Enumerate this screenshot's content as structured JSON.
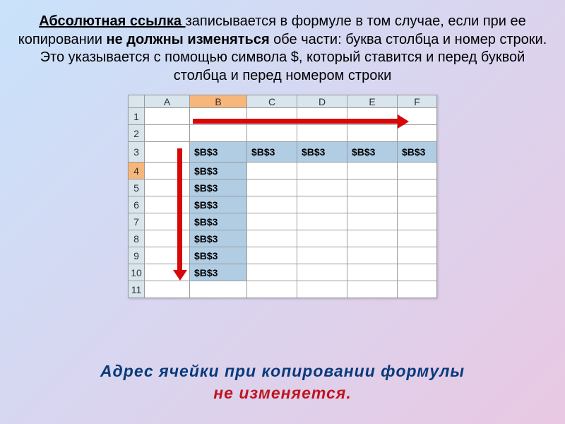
{
  "para": {
    "title": "Абсолютная ссылка ",
    "part1": "записывается в формуле в том случае, если при ее копировании ",
    "bold": "не должны изменяться",
    "part2": " обе части: буква столбца и номер строки. Это указывается с  помощью символа $, который ставится и перед буквой столбца и перед номером строки"
  },
  "sheet": {
    "cols": [
      "A",
      "B",
      "C",
      "D",
      "E",
      "F"
    ],
    "rows": [
      "1",
      "2",
      "3",
      "4",
      "5",
      "6",
      "7",
      "8",
      "9",
      "10",
      "11"
    ],
    "value": "$B$3"
  },
  "footer": {
    "line1": "Адрес  ячейки  при  копировании  формулы",
    "line2": "не изменяется."
  }
}
